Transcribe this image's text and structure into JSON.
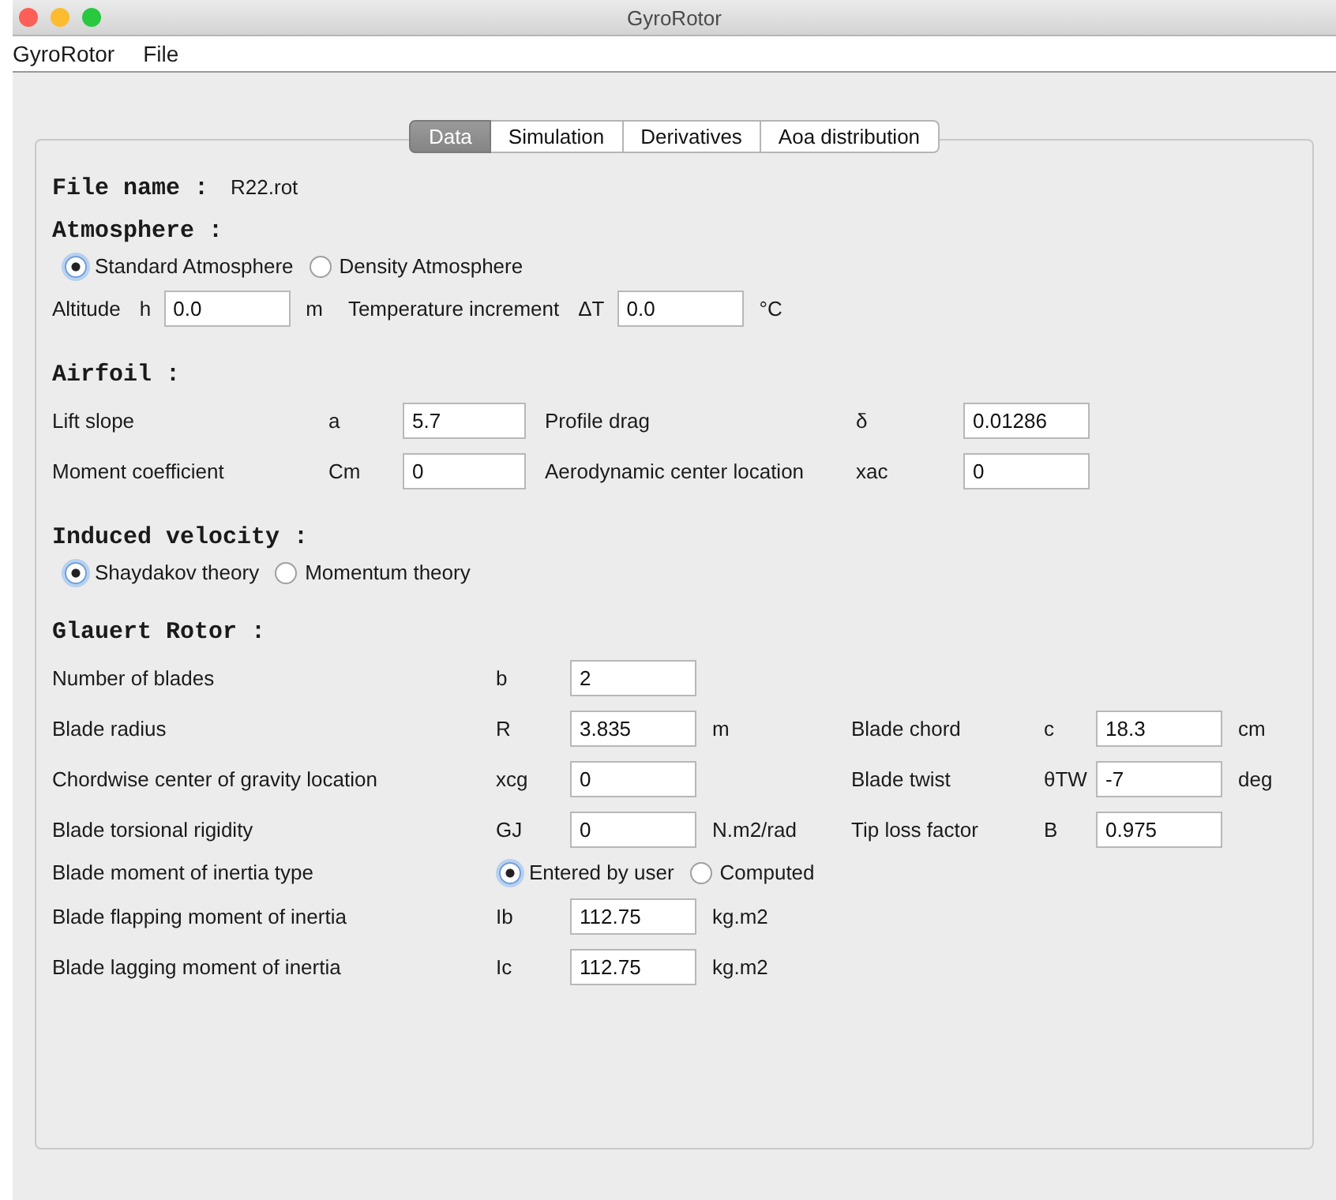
{
  "window": {
    "title": "GyroRotor"
  },
  "menu": [
    {
      "label": "GyroRotor"
    },
    {
      "label": "File"
    }
  ],
  "tabs": [
    {
      "label": "Data",
      "selected": true
    },
    {
      "label": "Simulation",
      "selected": false
    },
    {
      "label": "Derivatives",
      "selected": false
    },
    {
      "label": "Aoa distribution",
      "selected": false
    }
  ],
  "file_name": {
    "label": "File name :",
    "value": "R22.rot"
  },
  "atmosphere": {
    "heading": "Atmosphere :",
    "options": [
      {
        "label": "Standard Atmosphere",
        "selected": true
      },
      {
        "label": "Density Atmosphere",
        "selected": false
      }
    ],
    "fields": [
      {
        "label": "Altitude",
        "symbol": "h",
        "value": "0.0",
        "unit": "m"
      },
      {
        "label": "Temperature increment",
        "symbol": "ΔT",
        "value": "0.0",
        "unit": "°C"
      }
    ]
  },
  "airfoil": {
    "heading": "Airfoil :",
    "rows": [
      [
        {
          "label": "Lift slope",
          "symbol": "a",
          "value": "5.7"
        },
        {
          "label": "Profile drag",
          "symbol": "δ",
          "value": "0.01286"
        }
      ],
      [
        {
          "label": "Moment coefficient",
          "symbol": "Cm",
          "value": "0"
        },
        {
          "label": "Aerodynamic center location",
          "symbol": "xac",
          "value": "0"
        }
      ]
    ]
  },
  "induced_velocity": {
    "heading": "Induced velocity :",
    "options": [
      {
        "label": "Shaydakov theory",
        "selected": true
      },
      {
        "label": "Momentum theory",
        "selected": false
      }
    ]
  },
  "glauert_rotor": {
    "heading": "Glauert Rotor :",
    "rows": [
      {
        "kind": "fields",
        "fields": [
          {
            "label": "Number of blades",
            "symbol": "b",
            "value": "2"
          }
        ]
      },
      {
        "kind": "fields",
        "fields": [
          {
            "label": "Blade radius",
            "symbol": "R",
            "value": "3.835",
            "unit": "m"
          },
          {
            "label": "Blade chord",
            "symbol": "c",
            "value": "18.3",
            "unit": "cm"
          }
        ]
      },
      {
        "kind": "fields",
        "fields": [
          {
            "label": "Chordwise center of gravity location",
            "symbol": "xcg",
            "value": "0"
          },
          {
            "label": "Blade twist",
            "symbol": "θTW",
            "value": "-7",
            "unit": "deg"
          }
        ]
      },
      {
        "kind": "fields",
        "fields": [
          {
            "label": "Blade torsional rigidity",
            "symbol": "GJ",
            "value": "0",
            "unit": "N.m2/rad"
          },
          {
            "label": "Tip loss factor",
            "symbol": "B",
            "value": "0.975"
          }
        ]
      },
      {
        "kind": "choice",
        "label": "Blade moment of inertia type",
        "options": [
          {
            "label": "Entered by user",
            "selected": true
          },
          {
            "label": "Computed",
            "selected": false
          }
        ]
      },
      {
        "kind": "fields",
        "fields": [
          {
            "label": "Blade flapping moment of inertia",
            "symbol": "Ib",
            "value": "112.75",
            "unit": "kg.m2"
          }
        ]
      },
      {
        "kind": "fields",
        "fields": [
          {
            "label": "Blade lagging moment of inertia",
            "symbol": "Ic",
            "value": "112.75",
            "unit": "kg.m2"
          }
        ]
      }
    ]
  }
}
